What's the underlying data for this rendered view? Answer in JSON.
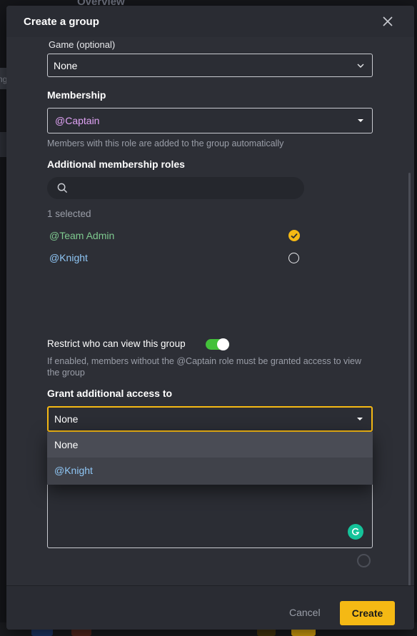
{
  "background": {
    "title": "Overview",
    "left_text": "ng"
  },
  "modal": {
    "title": "Create a group",
    "close_icon": "close-icon"
  },
  "game": {
    "label": "Game (optional)",
    "value": "None"
  },
  "membership": {
    "label": "Membership",
    "value": "@Captain",
    "value_color": "#e0a3f5",
    "help": "Members with this role are added to the group automatically"
  },
  "additional_roles": {
    "label": "Additional membership roles",
    "search_placeholder": "",
    "selected_count": "1 selected",
    "roles": [
      {
        "name": "@Team Admin",
        "color": "#7ec98f",
        "selected": true
      },
      {
        "name": "@Knight",
        "color": "#8fc6f5",
        "selected": false
      }
    ]
  },
  "restrict": {
    "label": "Restrict who can view this group",
    "enabled": true,
    "help": "If enabled, members without the @Captain role must be granted access to view the group"
  },
  "grant_access": {
    "label": "Grant additional access to",
    "value": "None",
    "options": [
      {
        "label": "None",
        "color": "#ffffff"
      },
      {
        "label": "@Knight",
        "color": "#8fc6f5"
      }
    ]
  },
  "footer": {
    "cancel_label": "Cancel",
    "create_label": "Create"
  },
  "colors": {
    "accent": "#f5b914",
    "toggle_on": "#43c13a",
    "check": "#f5b914"
  }
}
